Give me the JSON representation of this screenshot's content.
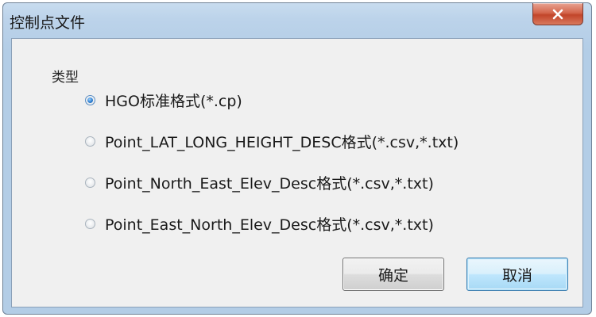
{
  "window": {
    "title": "控制点文件"
  },
  "group": {
    "label": "类型"
  },
  "options": [
    {
      "label": "HGO标准格式(*.cp)",
      "checked": true
    },
    {
      "label": "Point_LAT_LONG_HEIGHT_DESC格式(*.csv,*.txt)",
      "checked": false
    },
    {
      "label": "Point_North_East_Elev_Desc格式(*.csv,*.txt)",
      "checked": false
    },
    {
      "label": "Point_East_North_Elev_Desc格式(*.csv,*.txt)",
      "checked": false
    }
  ],
  "buttons": {
    "ok_label": "确定",
    "cancel_label": "取消"
  },
  "icons": {
    "close": "close-icon"
  },
  "colors": {
    "titlebar": "#bcd3ea",
    "close_button": "#c2452a",
    "dialog_body": "#f0f0f0",
    "focus_button": "#bee6fd"
  }
}
